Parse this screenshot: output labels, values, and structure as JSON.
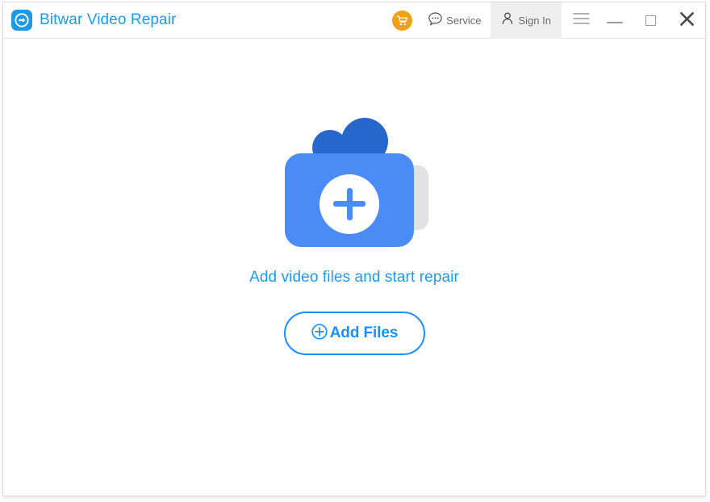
{
  "window": {
    "title": "Bitwar Video Repair",
    "logo_icon": "bitwar-logo-icon"
  },
  "titlebar": {
    "cart": {
      "icon": "shopping-cart-icon",
      "label": ""
    },
    "service": {
      "icon": "speech-bubble-icon",
      "label": "Service"
    },
    "sign_in": {
      "icon": "person-icon",
      "label": "Sign In"
    },
    "menu": {
      "icon": "hamburger-menu-icon"
    },
    "minimize": {
      "icon": "minimize-icon"
    },
    "maximize": {
      "icon": "maximize-icon"
    },
    "close": {
      "icon": "close-icon"
    }
  },
  "main": {
    "illustration_icon": "video-camera-add-icon",
    "hint_text": "Add video files and start repair",
    "add_files_button": {
      "icon": "plus-circle-icon",
      "label": "Add Files"
    }
  },
  "colors": {
    "brand_blue": "#1b9cf0",
    "accent_blue": "#1890ff",
    "camera_body_blue": "#4a8bf5",
    "camera_reel_blue": "#2766cb",
    "camera_lens_gray": "#e2e2e2",
    "cart_orange": "#f0a11b",
    "signin_highlight": "#efefef",
    "border_gray": "#dcdcdc",
    "text_gray": "#6b6b6b"
  }
}
